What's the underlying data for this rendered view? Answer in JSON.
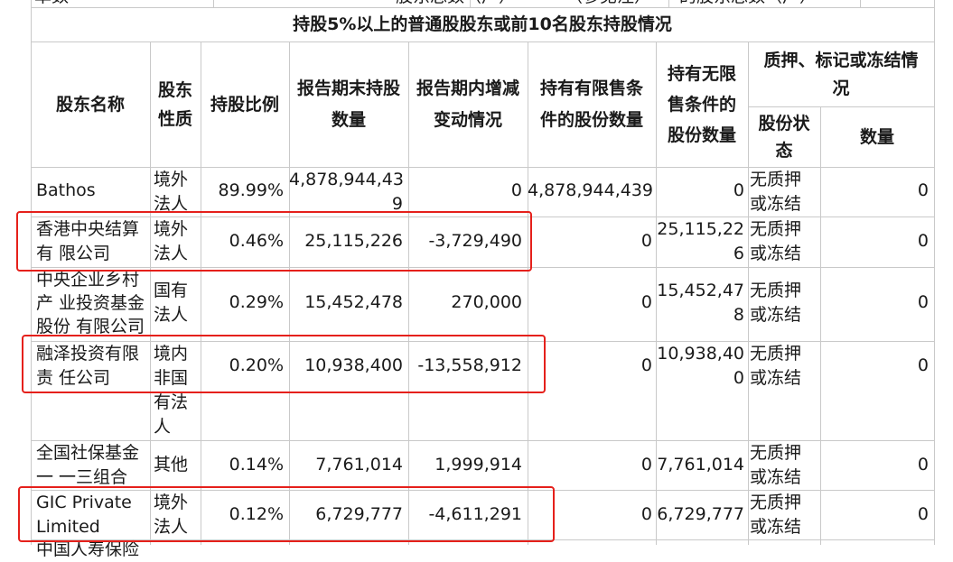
{
  "top_partial": {
    "c1": "单数",
    "c2": "股东总数（户）",
    "c3": "（参见注）",
    "c4": "的股东总数（户）"
  },
  "section_title": "持股5%以上的普通股股东或前10名股东持股情况",
  "headers": {
    "name": "股东名称",
    "nature_l1": "股东",
    "nature_l2": "性质",
    "ratio": "持股比例",
    "end_holding_l1": "报告期末持股",
    "end_holding_l2": "数量",
    "change_l1": "报告期内增减",
    "change_l2": "变动情况",
    "restricted_l1": "持有有限售条",
    "restricted_l2": "件的股份数量",
    "unrestricted_l1": "持有无限",
    "unrestricted_l2": "售条件的",
    "unrestricted_l3": "股份数量",
    "pledge_l1": "质押、标记或冻结情",
    "pledge_l2": "况",
    "status_l1": "股份状",
    "status_l2": "态",
    "quantity": "数量"
  },
  "rows": [
    {
      "name_l1": "Bathos",
      "name_l2": "",
      "name_l3": "",
      "nature_l1": "境外",
      "nature_l2": "法人",
      "nature_l3": "",
      "nature_l4": "",
      "ratio": "89.99%",
      "end_l1": "4,878,944,43",
      "end_l2": "9",
      "change": "0",
      "restricted": "4,878,944,439",
      "unres_l1": "0",
      "unres_l2": "",
      "status_l1": "无质押",
      "status_l2": "或冻结",
      "qty": "0"
    },
    {
      "name_l1": "香港中央结算",
      "name_l2": "有 限公司",
      "name_l3": "",
      "nature_l1": "境外",
      "nature_l2": "法人",
      "nature_l3": "",
      "nature_l4": "",
      "ratio": "0.46%",
      "end_l1": "25,115,226",
      "end_l2": "",
      "change": "-3,729,490",
      "restricted": "0",
      "unres_l1": "25,115,22",
      "unres_l2": "6",
      "status_l1": "无质押",
      "status_l2": "或冻结",
      "qty": "0"
    },
    {
      "name_l1": "中央企业乡村",
      "name_l2": "产 业投资基金",
      "name_l3": "股份 有限公司",
      "nature_l1": "国有",
      "nature_l2": "法人",
      "nature_l3": "",
      "nature_l4": "",
      "ratio": "0.29%",
      "end_l1": "15,452,478",
      "end_l2": "",
      "change": "270,000",
      "restricted": "0",
      "unres_l1": "15,452,47",
      "unres_l2": "8",
      "status_l1": "无质押",
      "status_l2": "或冻结",
      "qty": "0"
    },
    {
      "name_l1": "融泽投资有限",
      "name_l2": "责 任公司",
      "name_l3": "",
      "nature_l1": "境内",
      "nature_l2": "非国",
      "nature_l3": "有法",
      "nature_l4": "人",
      "ratio": "0.20%",
      "end_l1": "10,938,400",
      "end_l2": "",
      "change": "-13,558,912",
      "restricted": "0",
      "unres_l1": "10,938,40",
      "unres_l2": "0",
      "status_l1": "无质押",
      "status_l2": "或冻结",
      "qty": "0"
    },
    {
      "name_l1": "全国社保基金",
      "name_l2": "一 一三组合",
      "name_l3": "",
      "nature_l1": "其他",
      "nature_l2": "",
      "nature_l3": "",
      "nature_l4": "",
      "ratio": "0.14%",
      "end_l1": "7,761,014",
      "end_l2": "",
      "change": "1,999,914",
      "restricted": "0",
      "unres_l1": "7,761,014",
      "unres_l2": "",
      "status_l1": "无质押",
      "status_l2": "或冻结",
      "qty": "0"
    },
    {
      "name_l1": "GIC Private",
      "name_l2": "Limited",
      "name_l3": "",
      "nature_l1": "境外",
      "nature_l2": "法人",
      "nature_l3": "",
      "nature_l4": "",
      "ratio": "0.12%",
      "end_l1": "6,729,777",
      "end_l2": "",
      "change": "-4,611,291",
      "restricted": "0",
      "unres_l1": "6,729,777",
      "unres_l2": "",
      "status_l1": "无质押",
      "status_l2": "或冻结",
      "qty": "0"
    }
  ],
  "bottom_partial": "中国人寿保险",
  "colors": {
    "grid": "#c9c9c9",
    "highlight": "#e5201b",
    "text": "#1a1a1a"
  }
}
